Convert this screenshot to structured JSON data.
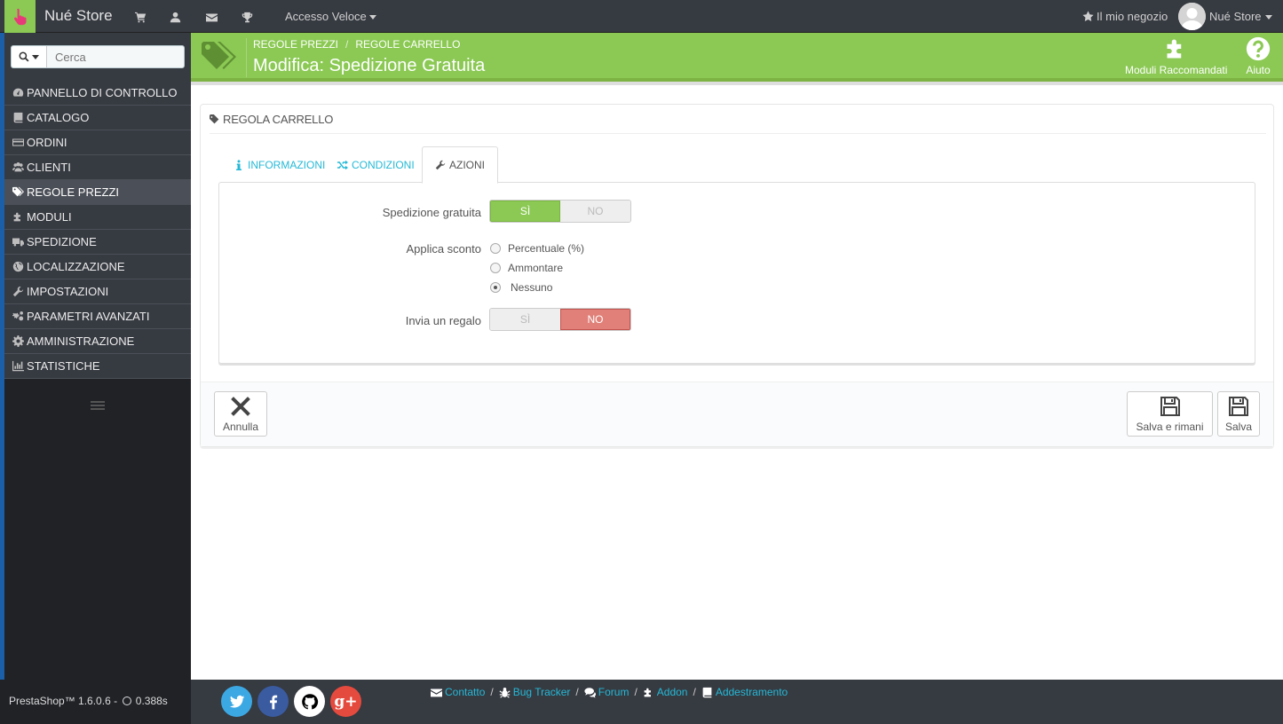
{
  "topbar": {
    "brand": "Nué Store",
    "quick_access": "Accesso Veloce",
    "my_store": "Il mio negozio",
    "user_name": "Nué Store"
  },
  "sidebar": {
    "search_placeholder": "Cerca",
    "items": [
      {
        "label": "PANNELLO DI CONTROLLO",
        "icon": "dashboard-icon"
      },
      {
        "label": "CATALOGO",
        "icon": "book-icon"
      },
      {
        "label": "ORDINI",
        "icon": "credit-card-icon"
      },
      {
        "label": "CLIENTI",
        "icon": "users-icon"
      },
      {
        "label": "REGOLE PREZZI",
        "icon": "tags-icon",
        "active": true
      },
      {
        "label": "MODULI",
        "icon": "puzzle-icon"
      },
      {
        "label": "SPEDIZIONE",
        "icon": "truck-icon"
      },
      {
        "label": "LOCALIZZAZIONE",
        "icon": "globe-icon"
      },
      {
        "label": "IMPOSTAZIONI",
        "icon": "wrench-icon"
      },
      {
        "label": "PARAMETRI AVANZATI",
        "icon": "cogs-icon"
      },
      {
        "label": "AMMINISTRAZIONE",
        "icon": "gear-icon"
      },
      {
        "label": "STATISTICHE",
        "icon": "bar-chart-icon"
      }
    ]
  },
  "header": {
    "breadcrumb_1": "REGOLE PREZZI",
    "breadcrumb_2": "REGOLE CARRELLO",
    "title": "Modifica: Spedizione Gratuita",
    "recommended_modules": "Moduli Raccomandati",
    "help": "Aiuto"
  },
  "panel": {
    "heading": "REGOLA CARRELLO",
    "tabs": [
      "INFORMAZIONI",
      "CONDIZIONI",
      "AZIONI"
    ],
    "free_shipping_label": "Spedizione gratuita",
    "free_shipping_yes": "SÌ",
    "free_shipping_no": "NO",
    "free_shipping_value": "SÌ",
    "apply_discount_label": "Applica sconto",
    "discount_options": [
      "Percentuale (%)",
      "Ammontare",
      "Nessuno"
    ],
    "discount_selected": "Nessuno",
    "gift_label": "Invia un regalo",
    "gift_yes": "SÌ",
    "gift_no": "NO",
    "gift_value": "NO",
    "cancel": "Annulla",
    "save_stay": "Salva e rimani",
    "save": "Salva"
  },
  "footer": {
    "version": "PrestaShop™ 1.6.0.6 -",
    "time": "0.388s",
    "links": [
      "Contatto",
      "Bug Tracker",
      "Forum",
      "Addon",
      "Addestramento"
    ]
  },
  "colors": {
    "brand_green": "#8bc954",
    "link_blue": "#25b9d7",
    "dark": "#363a41",
    "no_red": "#e08079"
  }
}
